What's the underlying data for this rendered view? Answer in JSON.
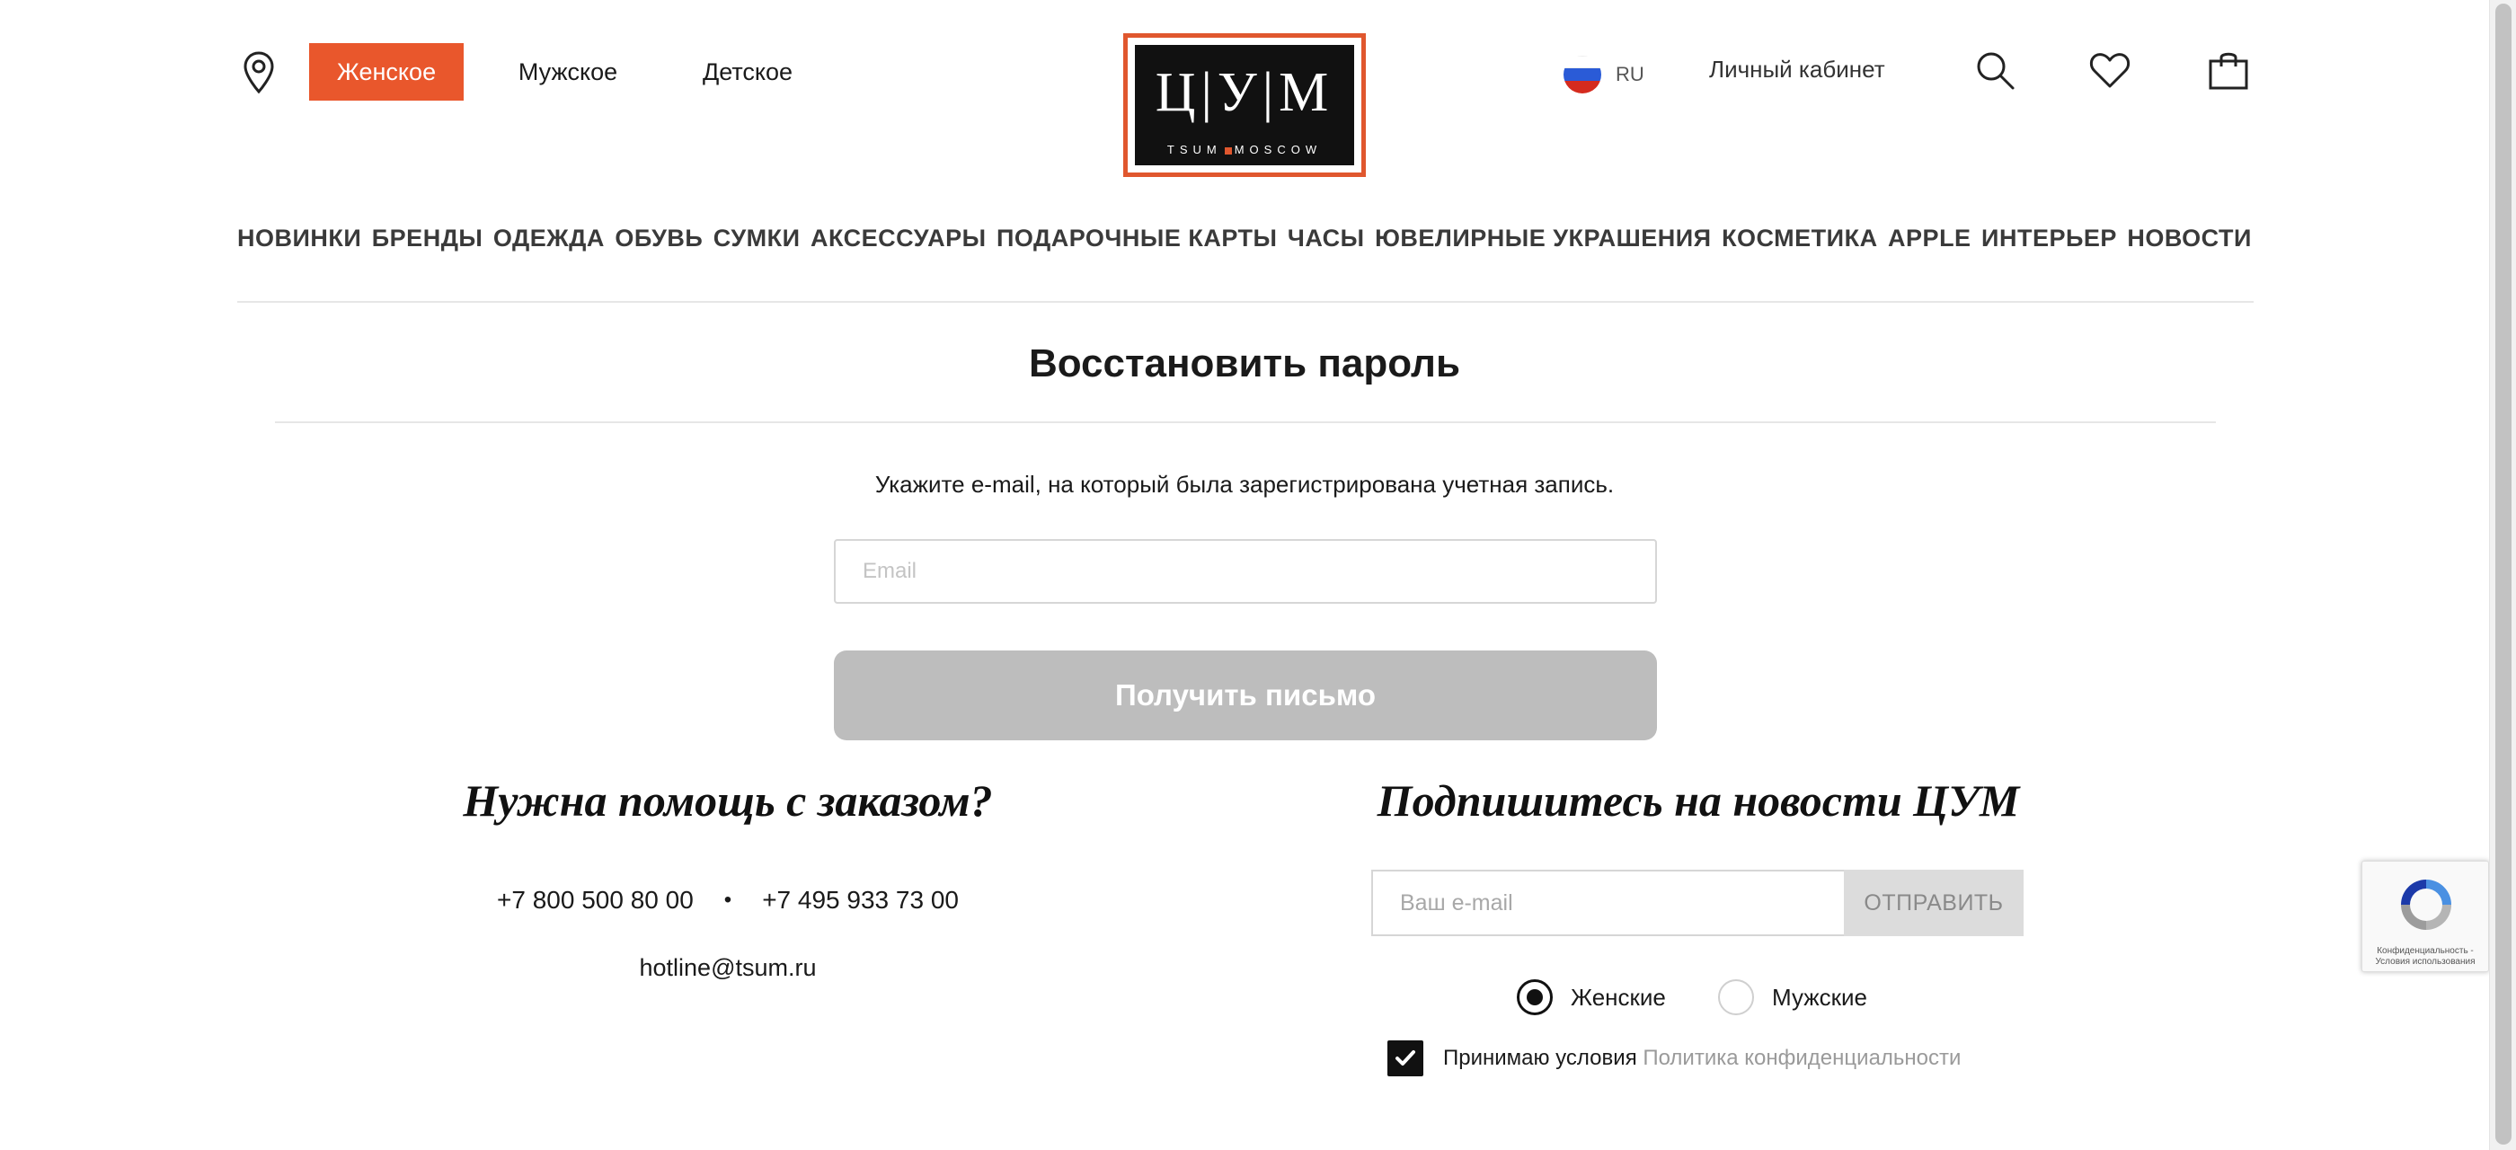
{
  "header": {
    "gender_tabs": [
      "Женское",
      "Мужское",
      "Детское"
    ],
    "language": "RU",
    "account_label": "Личный кабинет",
    "logo_letters": "Ц|У|М",
    "logo_subtitle_left": "TSUM",
    "logo_subtitle_right": "MOSCOW"
  },
  "nav": {
    "categories": [
      "НОВИНКИ",
      "БРЕНДЫ",
      "ОДЕЖДА",
      "ОБУВЬ",
      "СУМКИ",
      "АКСЕССУАРЫ",
      "ПОДАРОЧНЫЕ КАРТЫ",
      "ЧАСЫ",
      "ЮВЕЛИРНЫЕ УКРАШЕНИЯ",
      "КОСМЕТИКА",
      "APPLE",
      "ИНТЕРЬЕР",
      "НОВОСТИ"
    ]
  },
  "recovery": {
    "title": "Восстановить пароль",
    "hint": "Укажите e-mail, на который была зарегистрирована учетная запись.",
    "email_placeholder": "Email",
    "email_value": "",
    "submit_label": "Получить письмо"
  },
  "help": {
    "title": "Нужна помощь с заказом?",
    "phone_1": "+7 800 500 80 00",
    "separator": "•",
    "phone_2": "+7 495 933 73 00",
    "email": "hotline@tsum.ru"
  },
  "subscribe": {
    "title": "Подпишитесь на новости ЦУМ",
    "email_placeholder": "Ваш e-mail",
    "submit_label": "ОТПРАВИТЬ",
    "option_women": "Женские",
    "option_men": "Мужские",
    "selected_option": "Женские",
    "terms_text": "Принимаю условия",
    "policy_link": "Политика конфиденциальности",
    "terms_checked": true
  },
  "recaptcha": {
    "text": "Конфиденциальность - Условия использования"
  },
  "colors": {
    "accent": "#e9572c",
    "button_disabled": "#bdbdbd",
    "text": "#1a1a1a"
  },
  "icons": [
    "location-icon",
    "flag-ru-icon",
    "search-icon",
    "heart-icon",
    "bag-icon",
    "check-icon",
    "recaptcha-icon"
  ]
}
